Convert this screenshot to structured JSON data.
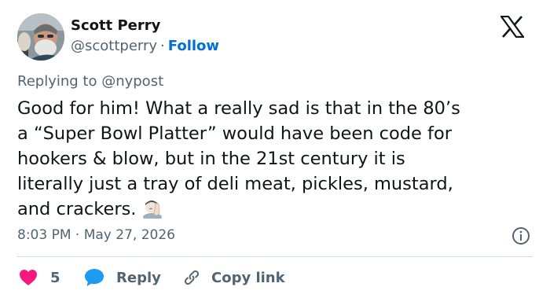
{
  "author": {
    "name": "Scott Perry",
    "handle": "@scottperry",
    "separator": "·",
    "follow_label": "Follow"
  },
  "reply_context": "Replying to @nypost",
  "tweet": {
    "lines": [
      "Good for him! What a really sad is that in the 80’s",
      "a “Super Bowl Platter” would have been code for",
      "hookers & blow, but in the 21st century it is",
      "literally just a tray of deli meat, pickles, mustard,",
      "and crackers."
    ],
    "emoji": "face-palm-emoji"
  },
  "timestamp": "8:03 PM · May 27, 2026",
  "actions": {
    "like_count": "5",
    "reply_label": "Reply",
    "copy_link_label": "Copy link"
  },
  "colors": {
    "link_blue": "#006fd6",
    "like_red": "#f91880",
    "reply_blue": "#1d9bf0",
    "muted_text": "#536471",
    "divider": "#cfd9de"
  },
  "icons": [
    "x-logo-icon",
    "info-icon",
    "heart-icon",
    "speech-bubble-icon",
    "link-icon"
  ]
}
